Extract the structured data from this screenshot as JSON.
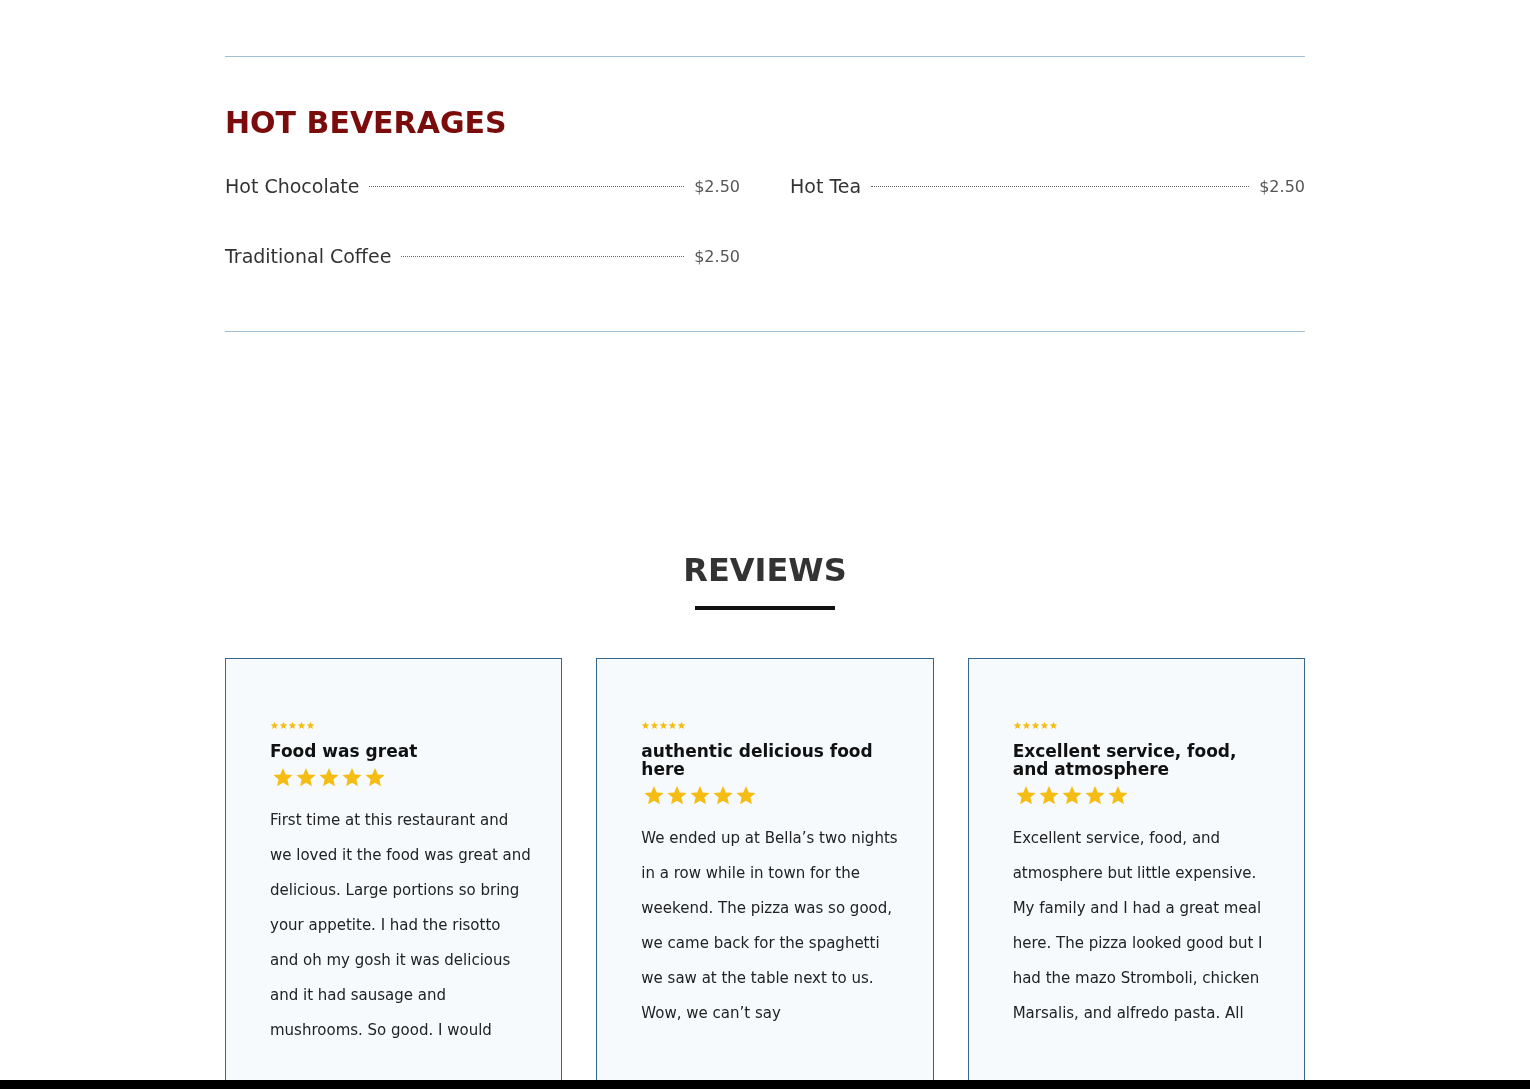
{
  "menu_section": {
    "title": "HOT BEVERAGES",
    "items": [
      {
        "name": "Hot Chocolate",
        "price": "$2.50"
      },
      {
        "name": "Hot Tea",
        "price": "$2.50"
      },
      {
        "name": "Traditional Coffee",
        "price": "$2.50"
      }
    ]
  },
  "reviews": {
    "title": "REVIEWS",
    "cards": [
      {
        "small_rating": {
          "stars": 5
        },
        "title": "Food was great",
        "stars": 5,
        "text": "First time at this restaurant and we loved it the food was great and delicious. Large portions so bring your appetite. I had the risotto and oh my gosh it was delicious and it had sausage and mushrooms. So good. I would"
      },
      {
        "small_rating": {
          "stars": 5
        },
        "title": "authentic delicious food here",
        "stars": 5,
        "text": "We ended up at Bella’s two nights in a row while in town for the weekend. The pizza was so good, we came back for the spaghetti we saw at the table next to us. Wow, we can’t say"
      },
      {
        "small_rating": {
          "stars": 5
        },
        "title": "Excellent service, food, and atmosphere",
        "stars": 5,
        "text": "Excellent service, food, and atmosphere but little expensive. My family and I had a great meal here. The pizza looked good but I had the mazo Stromboli, chicken Marsalis, and alfredo pasta. All"
      }
    ]
  }
}
